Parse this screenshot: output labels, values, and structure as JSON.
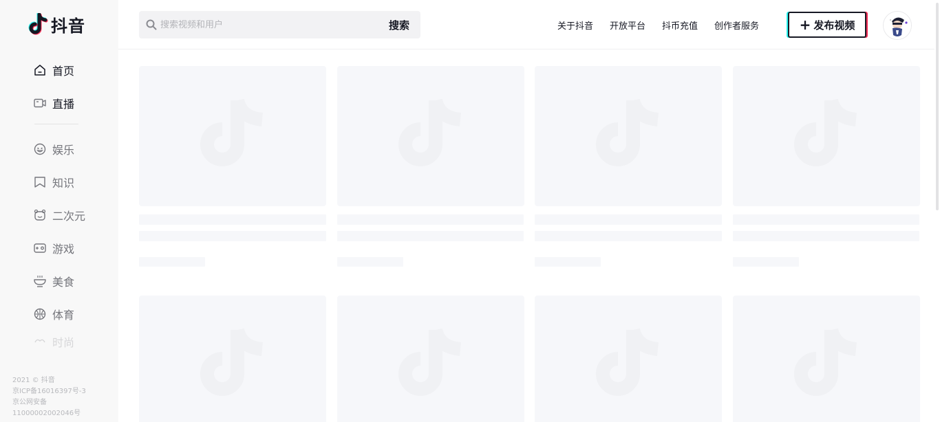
{
  "brand": {
    "name": "抖音"
  },
  "sidebar": {
    "items": [
      {
        "label": "首页",
        "icon": "home-icon"
      },
      {
        "label": "直播",
        "icon": "live-icon"
      },
      {
        "label": "娱乐",
        "icon": "smile-icon"
      },
      {
        "label": "知识",
        "icon": "bookmark-icon"
      },
      {
        "label": "二次元",
        "icon": "bear-icon"
      },
      {
        "label": "游戏",
        "icon": "gamepad-icon"
      },
      {
        "label": "美食",
        "icon": "bowl-icon"
      },
      {
        "label": "体育",
        "icon": "ball-icon"
      },
      {
        "label": "时尚",
        "icon": "fashion-icon"
      }
    ],
    "footer": [
      "2021 © 抖音",
      "京ICP备16016397号-3",
      "京公网安备",
      "11000002002046号"
    ]
  },
  "header": {
    "search_placeholder": "搜索视频和用户",
    "search_button": "搜索",
    "links": [
      "关于抖音",
      "开放平台",
      "抖币充值",
      "创作者服务"
    ],
    "publish_label": "发布视频"
  },
  "colors": {
    "accent_cyan": "#25f4ee",
    "accent_red": "#fe2c55",
    "text": "#161823",
    "placeholder": "#f6f7fa"
  },
  "feed": {
    "cards_loading": 8
  }
}
